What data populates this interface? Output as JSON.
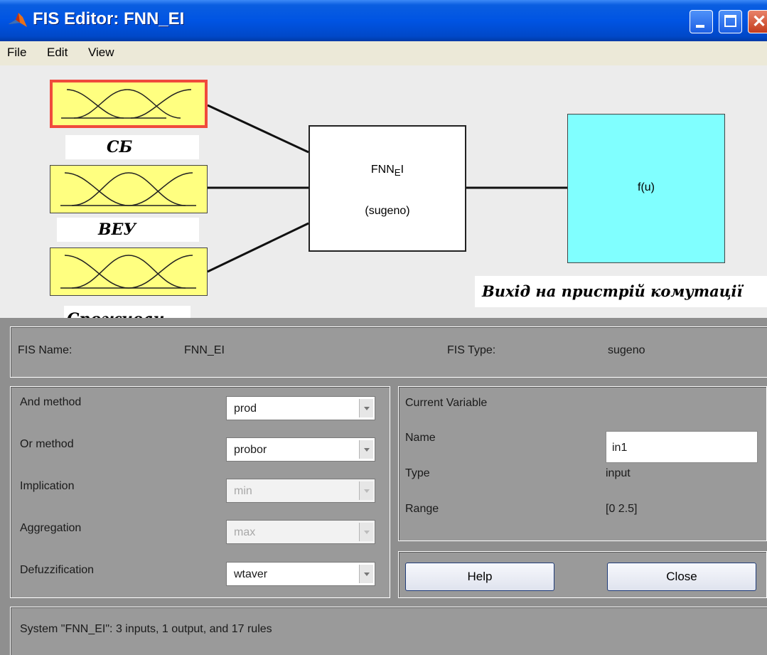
{
  "window": {
    "title": "FIS Editor: FNN_EI"
  },
  "menu": [
    "File",
    "Edit",
    "View"
  ],
  "diagram": {
    "inputs": [
      {
        "label": "СБ",
        "selected": true
      },
      {
        "label": "ВЕУ",
        "selected": false
      },
      {
        "label": "Споживач",
        "selected": false
      }
    ],
    "fis_box": {
      "name": "FNN_EI",
      "type": "(sugeno)"
    },
    "output_box": {
      "text": "f(u)",
      "label": "Вихід на пристрій комутації"
    },
    "colors": {
      "input_fill": "#ffff80",
      "output_fill": "#80ffff",
      "selected_border": "#f04a3c"
    }
  },
  "fis_info": {
    "name_label": "FIS Name:",
    "name_value": "FNN_EI",
    "type_label": "FIS Type:",
    "type_value": "sugeno"
  },
  "methods": {
    "and_method": {
      "label": "And method",
      "value": "prod",
      "enabled": true
    },
    "or_method": {
      "label": "Or method",
      "value": "probor",
      "enabled": true
    },
    "implication": {
      "label": "Implication",
      "value": "min",
      "enabled": false
    },
    "aggregation": {
      "label": "Aggregation",
      "value": "max",
      "enabled": false
    },
    "defuzzification": {
      "label": "Defuzzification",
      "value": "wtaver",
      "enabled": true
    }
  },
  "current_variable": {
    "title": "Current Variable",
    "name_label": "Name",
    "name_value": "in1",
    "type_label": "Type",
    "type_value": "input",
    "range_label": "Range",
    "range_value": "[0 2.5]"
  },
  "buttons": {
    "help": "Help",
    "close": "Close"
  },
  "status": "System \"FNN_EI\": 3 inputs, 1 output, and 17 rules"
}
